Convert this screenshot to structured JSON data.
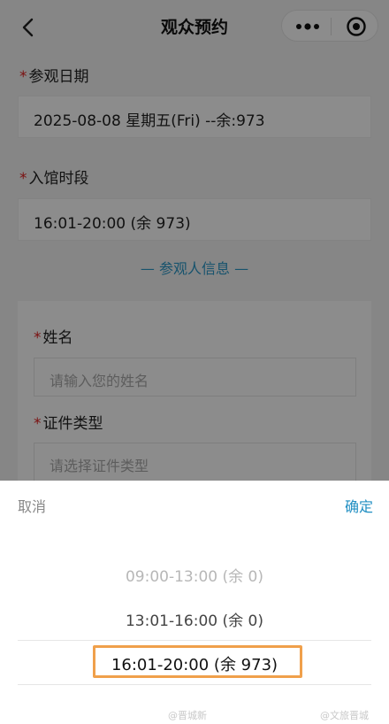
{
  "header": {
    "title": "观众预约",
    "back_icon": "chevron-left-icon"
  },
  "capsule": {
    "more_icon": "more-dots-icon",
    "close_icon": "target-circle-icon"
  },
  "form": {
    "required_mark": "*",
    "visit_date": {
      "label": "参观日期",
      "value": "2025-08-08 星期五(Fri) --余:973"
    },
    "time_slot": {
      "label": "入馆时段",
      "value": "16:01-20:00 (余 973)"
    },
    "section_title": "— 参观人信息 —",
    "name": {
      "label": "姓名",
      "placeholder": "请输入您的姓名"
    },
    "id_type": {
      "label": "证件类型",
      "placeholder": "请选择证件类型"
    }
  },
  "picker": {
    "cancel": "取消",
    "confirm": "确定",
    "options": [
      "09:00-13:00 (余 0)",
      "13:01-16:00 (余 0)",
      "16:01-20:00 (余 973)"
    ],
    "selected_index": 2,
    "highlight_color": "#f0a04b"
  },
  "watermarks": [
    "@晋城新",
    "@文旅晋城"
  ],
  "colors": {
    "accent": "#1f8ec2",
    "required": "#e02020"
  }
}
